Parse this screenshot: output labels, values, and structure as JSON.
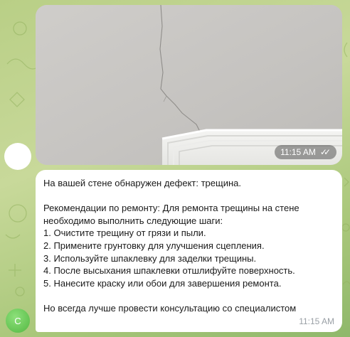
{
  "photo_message": {
    "time": "11:15 AM",
    "status_icon": "double-check-icon"
  },
  "text_message": {
    "lines": [
      "На вашей стене обнаружен дефект: трещина.",
      "",
      "Рекомендации по ремонту: Для ремонта трещины на стене",
      "необходимо выполнить следующие шаги:",
      "1. Очистите трещину от грязи и пыли.",
      "2. Примените грунтовку для улучшения сцепления.",
      "3. Используйте шпаклевку для заделки трещины.",
      "4. После высыхания шпаклевки отшлифуйте поверхность.",
      "5. Нанесите краску или обои для завершения ремонта.",
      "",
      "Но всегда лучше провести консультацию со специалистом"
    ],
    "time": "11:15 AM"
  },
  "bot_avatar": {
    "initial": "C",
    "color": "#53b842"
  }
}
